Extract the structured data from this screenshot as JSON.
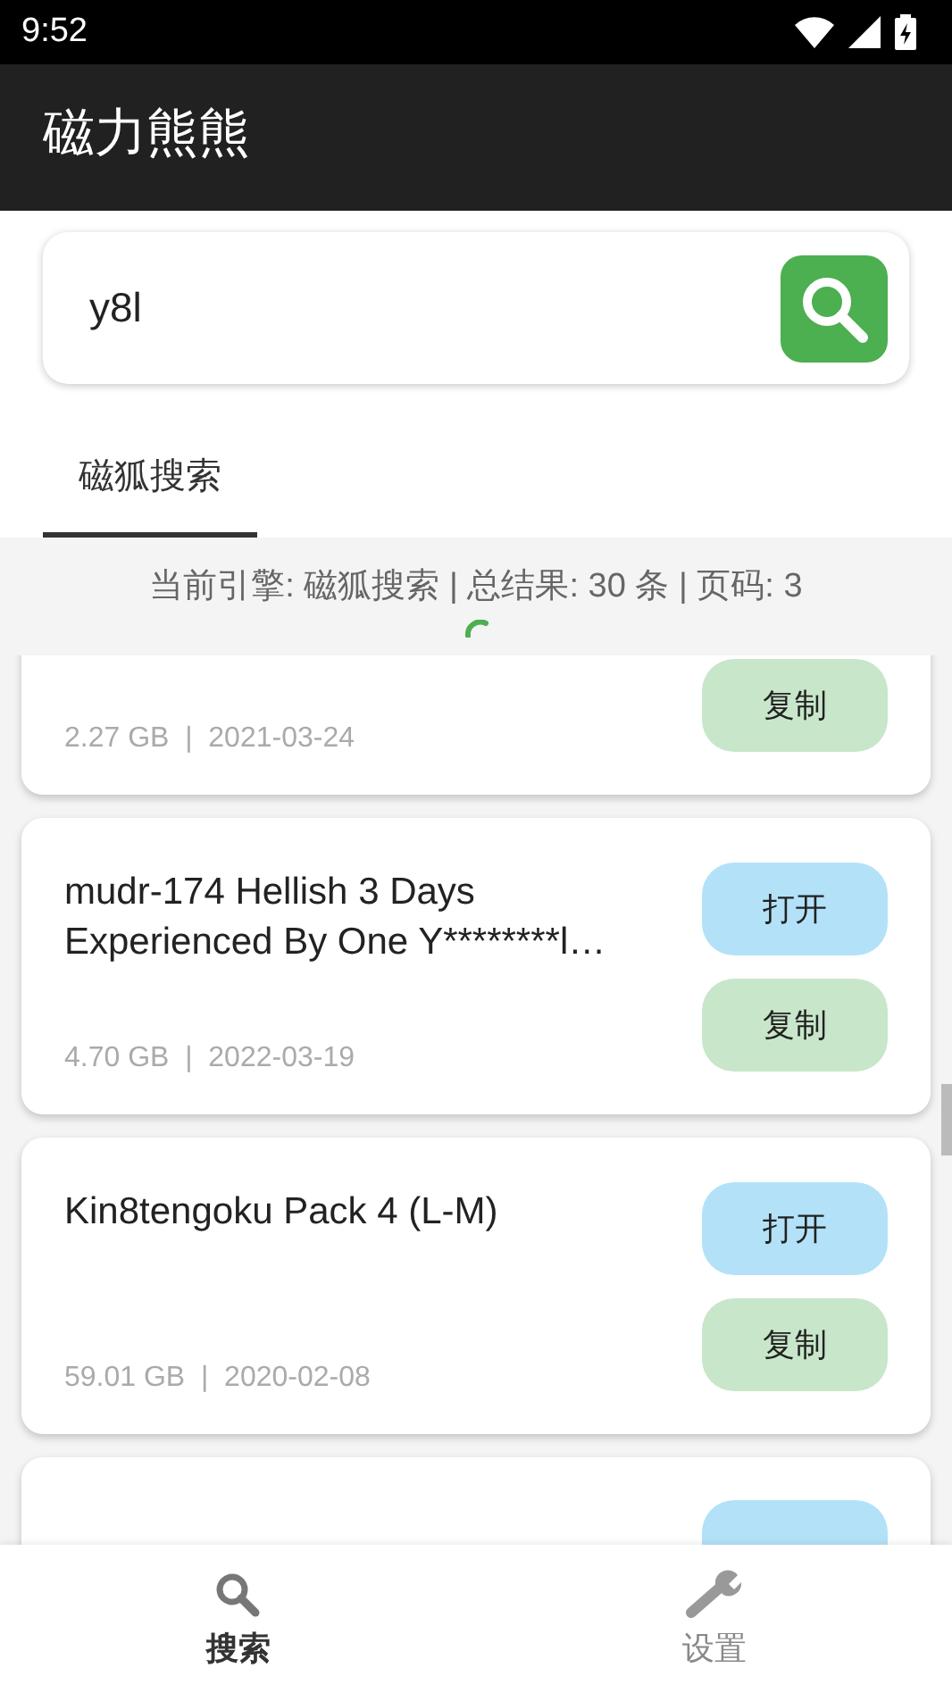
{
  "status_bar": {
    "time": "9:52"
  },
  "app_bar": {
    "title": "磁力熊熊"
  },
  "search": {
    "value": "y8l"
  },
  "tabs": [
    {
      "label": "磁狐搜索",
      "selected": true
    }
  ],
  "info": "当前引擎: 磁狐搜索 | 总结果: 30 条 | 页码: 3",
  "results": [
    {
      "meta": "2.27 GB  |  2021-03-24",
      "buttons": [
        {
          "kind": "copy",
          "label": "复制"
        }
      ]
    },
    {
      "title": "mudr-174 Hellish 3 Days Experienced By One Y********l…",
      "meta": "4.70 GB  |  2022-03-19",
      "buttons": [
        {
          "kind": "open",
          "label": "打开"
        },
        {
          "kind": "copy",
          "label": "复制"
        }
      ]
    },
    {
      "title": "Kin8tengoku Pack 4 (L-M)",
      "meta": "59.01 GB  |  2020-02-08",
      "buttons": [
        {
          "kind": "open",
          "label": "打开"
        },
        {
          "kind": "copy",
          "label": "复制"
        }
      ]
    },
    {
      "buttons": [
        {
          "kind": "open"
        }
      ]
    }
  ],
  "bottom_nav": [
    {
      "kind": "search",
      "label": "搜索",
      "selected": true
    },
    {
      "kind": "settings",
      "label": "设置",
      "selected": false
    }
  ]
}
